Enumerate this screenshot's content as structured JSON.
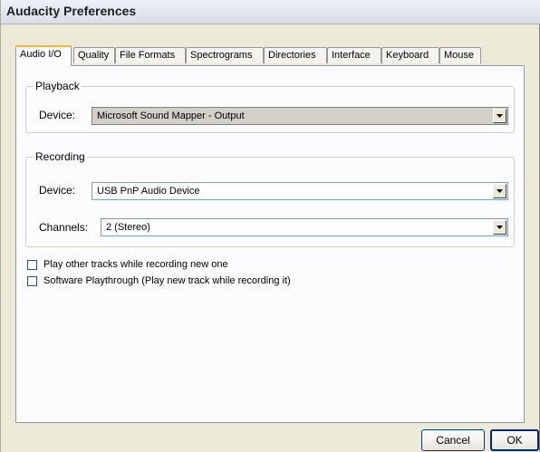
{
  "window": {
    "title": "Audacity Preferences"
  },
  "tabs": [
    {
      "label": "Audio I/O",
      "active": true
    },
    {
      "label": "Quality"
    },
    {
      "label": "File Formats"
    },
    {
      "label": "Spectrograms"
    },
    {
      "label": "Directories"
    },
    {
      "label": "Interface"
    },
    {
      "label": "Keyboard"
    },
    {
      "label": "Mouse"
    }
  ],
  "playback": {
    "legend": "Playback",
    "device_label": "Device:",
    "device_value": "Microsoft Sound Mapper - Output"
  },
  "recording": {
    "legend": "Recording",
    "device_label": "Device:",
    "device_value": "USB PnP Audio Device",
    "channels_label": "Channels:",
    "channels_value": "2 (Stereo)"
  },
  "options": {
    "play_other_tracks": {
      "label": "Play other tracks while recording new one",
      "checked": false
    },
    "software_playthrough": {
      "label": "Software Playthrough (Play new track while recording it)",
      "checked": false
    }
  },
  "buttons": {
    "cancel": "Cancel",
    "ok": "OK"
  }
}
